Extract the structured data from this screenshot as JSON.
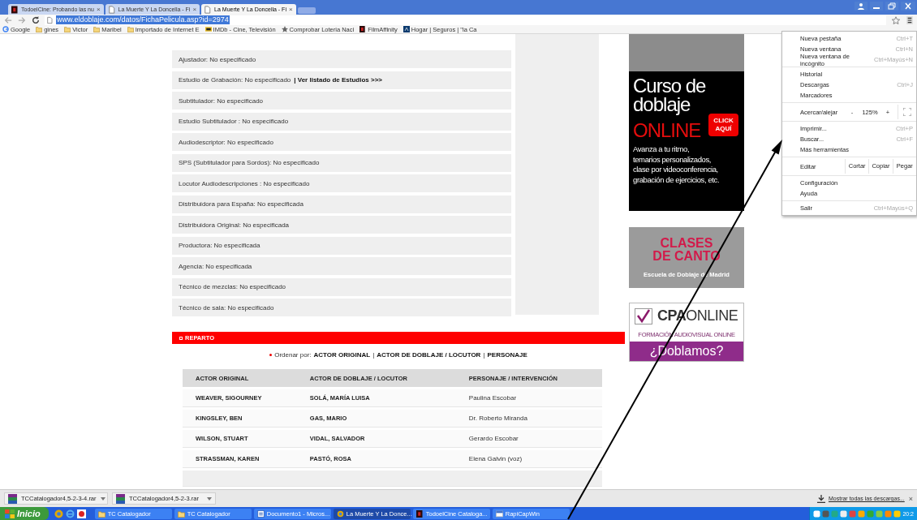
{
  "tabs": [
    {
      "title": "TodoelCine: Probando las nu",
      "kind": "film",
      "selected": false
    },
    {
      "title": "La Muerte Y La Doncella - Fi",
      "kind": "page",
      "selected": false
    },
    {
      "title": "La Muerte Y La Doncella - Fi",
      "kind": "page",
      "selected": true
    }
  ],
  "tab_close": "×",
  "address": {
    "url": "www.eldoblaje.com/datos/FichaPelicula.asp?id=2974"
  },
  "bookmarks": [
    {
      "label": "Google",
      "kind": "google"
    },
    {
      "label": "gines",
      "kind": "folder"
    },
    {
      "label": "Victor",
      "kind": "folder"
    },
    {
      "label": "Maribel",
      "kind": "folder"
    },
    {
      "label": "Importado de Internet E",
      "kind": "folder"
    },
    {
      "label": "IMDb - Cine, Televisión",
      "kind": "imdb"
    },
    {
      "label": "Comprobar Loteria Naci",
      "kind": "lottery"
    },
    {
      "label": "FilmAffinity",
      "kind": "film"
    },
    {
      "label": "Hogar | Seguros | \"la Ca",
      "kind": "bank"
    }
  ],
  "credits": [
    {
      "text": "Ajustador: No especificado"
    },
    {
      "text": "Estudio de Grabación: No especificado",
      "link": "| Ver listado de Estudios >>>"
    },
    {
      "text": "Subtitulador: No especificado"
    },
    {
      "text": "Estudio Subtitulador : No especificado"
    },
    {
      "text": "Audiodescriptor: No especificado"
    },
    {
      "text": "SPS (Subtitulador para Sordos): No especificado"
    },
    {
      "text": "Locutor Audiodescripciones : No especificado"
    },
    {
      "text": "Distribuidora para España: No especificada"
    },
    {
      "text": "Distribuidora Original: No especificada"
    },
    {
      "text": "Productora: No especificada"
    },
    {
      "text": "Agencia: No especificada"
    },
    {
      "text": "Técnico de mezclas: No especificado"
    },
    {
      "text": "Técnico de sala: No especificado"
    }
  ],
  "cast": {
    "title": "REPARTO",
    "sort_label": "Ordenar por:",
    "sort_options": [
      "ACTOR ORIGINAL",
      "ACTOR DE DOBLAJE / LOCUTOR",
      "PERSONAJE"
    ],
    "sort_separator": "|",
    "columns": [
      "ACTOR ORIGINAL",
      "ACTOR DE DOBLAJE / LOCUTOR",
      "PERSONAJE / INTERVENCIÓN"
    ],
    "rows": [
      [
        "WEAVER, SIGOURNEY",
        "SOLÁ, MARÍA LUISA",
        "Paulina Escobar"
      ],
      [
        "KINGSLEY, BEN",
        "GAS, MARIO",
        "Dr. Roberto Miranda"
      ],
      [
        "WILSON, STUART",
        "VIDAL, SALVADOR",
        "Gerardo Escobar"
      ],
      [
        "STRASSMAN, KAREN",
        "PASTÓ, ROSA",
        "Elena Galvin (voz)"
      ]
    ]
  },
  "ads": {
    "course": {
      "title_lines": [
        "Curso de",
        "doblaje"
      ],
      "highlight": "ONLINE",
      "button_lines": [
        "CLICK",
        "AQUÍ"
      ],
      "description_lines": [
        "Avanza a tu ritmo,",
        "temarios personalizados,",
        "clase por videoconferencia,",
        "grabación de ejercicios, etc."
      ]
    },
    "singing": {
      "title_lines": [
        "CLASES",
        "DE CANTO"
      ],
      "subtitle": "Escuela de Doblaje de Madrid"
    },
    "cpa": {
      "logo": "**CPA**ONLINE",
      "tagline": "FORMACIÓN AUDIOVISUAL ONLINE",
      "call": "¿Doblamos?"
    }
  },
  "menu": [
    {
      "kind": "item",
      "label": "Nueva pestaña",
      "shortcut": "Ctrl+T"
    },
    {
      "kind": "item",
      "label": "Nueva ventana",
      "shortcut": "Ctrl+N"
    },
    {
      "kind": "item",
      "label": "Nueva ventana de incógnito",
      "shortcut": "Ctrl+Mayús+N"
    },
    {
      "kind": "separator"
    },
    {
      "kind": "item",
      "label": "Historial"
    },
    {
      "kind": "item",
      "label": "Descargas",
      "shortcut": "Ctrl+J"
    },
    {
      "kind": "item",
      "label": "Marcadores"
    },
    {
      "kind": "separator"
    },
    {
      "kind": "zoom",
      "label": "Acercar/alejar",
      "minus": "-",
      "value": "125%",
      "plus": "+"
    },
    {
      "kind": "separator"
    },
    {
      "kind": "item",
      "label": "Imprimir...",
      "shortcut": "Ctrl+P"
    },
    {
      "kind": "item",
      "label": "Buscar...",
      "shortcut": "Ctrl+F"
    },
    {
      "kind": "item",
      "label": "Más herramientas"
    },
    {
      "kind": "separator"
    },
    {
      "kind": "edit",
      "label": "Editar",
      "actions": [
        "Cortar",
        "Copiar",
        "Pegar"
      ]
    },
    {
      "kind": "separator"
    },
    {
      "kind": "item",
      "label": "Configuración"
    },
    {
      "kind": "item",
      "label": "Ayuda"
    },
    {
      "kind": "separator"
    },
    {
      "kind": "item",
      "label": "Salir",
      "shortcut": "Ctrl+Mayús+Q"
    }
  ],
  "downloads": {
    "items": [
      "TCCatalogador4,5-2-3-4.rar",
      "TCCatalogador4,5-2-3.rar"
    ],
    "show_all": "Mostrar todas las descargas...",
    "close": "×"
  },
  "taskbar": {
    "start": "Inicio",
    "tasks": [
      {
        "label": "TC Catalogador",
        "kind": "folder",
        "selected": false
      },
      {
        "label": "TC Catalogador",
        "kind": "folder",
        "selected": false
      },
      {
        "label": "Documento1 - Micros...",
        "kind": "doc",
        "selected": false
      },
      {
        "label": "La Muerte Y La Donce...",
        "kind": "browser",
        "selected": true
      },
      {
        "label": "TodoelCine Cataloga...",
        "kind": "film",
        "selected": false
      },
      {
        "label": "RapiCapWin",
        "kind": "app",
        "selected": false
      }
    ],
    "clock": "20:2"
  }
}
